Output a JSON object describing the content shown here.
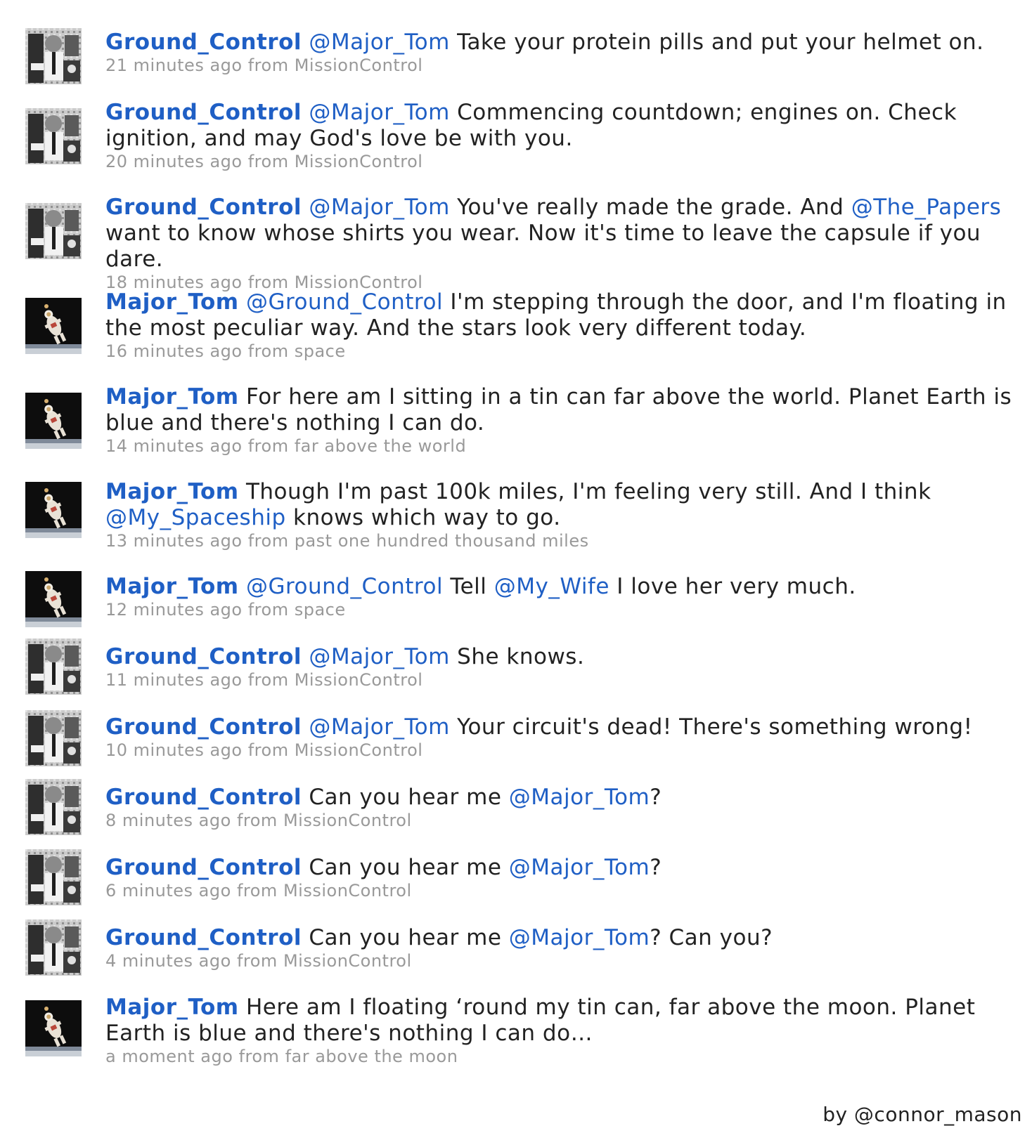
{
  "tweets": [
    {
      "avatar": "ground-control-avatar",
      "author": "Ground_Control",
      "parts": [
        {
          "t": "m",
          "v": "@Major_Tom"
        },
        {
          "t": "s",
          "v": " Take your protein pills and put your helmet on."
        }
      ],
      "time": "21 minutes ago",
      "source": "MissionControl"
    },
    {
      "avatar": "ground-control-avatar",
      "author": "Ground_Control",
      "parts": [
        {
          "t": "m",
          "v": "@Major_Tom"
        },
        {
          "t": "s",
          "v": " Commencing countdown; engines on. Check ignition, and may God's love be with you."
        }
      ],
      "time": "20 minutes ago",
      "source": "MissionControl"
    },
    {
      "avatar": "ground-control-avatar",
      "author": "Ground_Control",
      "parts": [
        {
          "t": "m",
          "v": "@Major_Tom"
        },
        {
          "t": "s",
          "v": " You've really made the grade. And "
        },
        {
          "t": "m",
          "v": "@The_Papers"
        },
        {
          "t": "s",
          "v": " want to know whose shirts you wear. Now it's time to leave the capsule if you dare."
        }
      ],
      "time": "18 minutes ago",
      "source": "MissionControl"
    },
    {
      "avatar": "major-tom-avatar",
      "author": "Major_Tom",
      "parts": [
        {
          "t": "m",
          "v": "@Ground_Control"
        },
        {
          "t": "s",
          "v": " I'm stepping through the door, and I'm floating in the most peculiar way. And the stars look very different today."
        }
      ],
      "time": "16 minutes ago",
      "source": "space"
    },
    {
      "avatar": "major-tom-avatar",
      "author": "Major_Tom",
      "parts": [
        {
          "t": "s",
          "v": "For here am I sitting in a tin can far above the world. Planet Earth is blue and there's nothing I can do."
        }
      ],
      "time": "14 minutes ago",
      "source": "far above the world"
    },
    {
      "avatar": "major-tom-avatar",
      "author": "Major_Tom",
      "parts": [
        {
          "t": "s",
          "v": "Though I'm past 100k miles, I'm feeling very still. And I think "
        },
        {
          "t": "m",
          "v": "@My_Spaceship"
        },
        {
          "t": "s",
          "v": " knows which way to go."
        }
      ],
      "time": "13 minutes ago",
      "source": "past one hundred thousand miles"
    },
    {
      "avatar": "major-tom-avatar",
      "author": "Major_Tom",
      "parts": [
        {
          "t": "m",
          "v": "@Ground_Control"
        },
        {
          "t": "s",
          "v": " Tell "
        },
        {
          "t": "m",
          "v": "@My_Wife"
        },
        {
          "t": "s",
          "v": " I love her very much."
        }
      ],
      "time": "12 minutes ago",
      "source": "space"
    },
    {
      "avatar": "ground-control-avatar",
      "author": "Ground_Control",
      "parts": [
        {
          "t": "m",
          "v": "@Major_Tom"
        },
        {
          "t": "s",
          "v": " She knows."
        }
      ],
      "time": "11 minutes ago",
      "source": "MissionControl"
    },
    {
      "avatar": "ground-control-avatar",
      "author": "Ground_Control",
      "parts": [
        {
          "t": "m",
          "v": "@Major_Tom"
        },
        {
          "t": "s",
          "v": " Your circuit's dead! There's something wrong!"
        }
      ],
      "time": "10 minutes ago",
      "source": "MissionControl"
    },
    {
      "avatar": "ground-control-avatar",
      "author": "Ground_Control",
      "parts": [
        {
          "t": "s",
          "v": "Can you hear me "
        },
        {
          "t": "m",
          "v": "@Major_Tom"
        },
        {
          "t": "s",
          "v": "?"
        }
      ],
      "time": "8 minutes ago",
      "source": "MissionControl"
    },
    {
      "avatar": "ground-control-avatar",
      "author": "Ground_Control",
      "parts": [
        {
          "t": "s",
          "v": "Can you hear me "
        },
        {
          "t": "m",
          "v": "@Major_Tom"
        },
        {
          "t": "s",
          "v": "?"
        }
      ],
      "time": "6 minutes ago",
      "source": "MissionControl"
    },
    {
      "avatar": "ground-control-avatar",
      "author": "Ground_Control",
      "parts": [
        {
          "t": "s",
          "v": "Can you hear me "
        },
        {
          "t": "m",
          "v": "@Major_Tom"
        },
        {
          "t": "s",
          "v": "? Can you?"
        }
      ],
      "time": "4 minutes ago",
      "source": "MissionControl"
    },
    {
      "avatar": "major-tom-avatar",
      "author": "Major_Tom",
      "parts": [
        {
          "t": "s",
          "v": "Here am I floating ‘round my tin can, far above the moon. Planet Earth is blue and there's nothing I can do…"
        }
      ],
      "time": "a moment ago",
      "source": "far above the moon"
    }
  ],
  "from_label": "from",
  "credit": "by @connor_mason",
  "colors": {
    "link": "#1f5fc5",
    "text": "#222222",
    "meta": "#999999"
  }
}
